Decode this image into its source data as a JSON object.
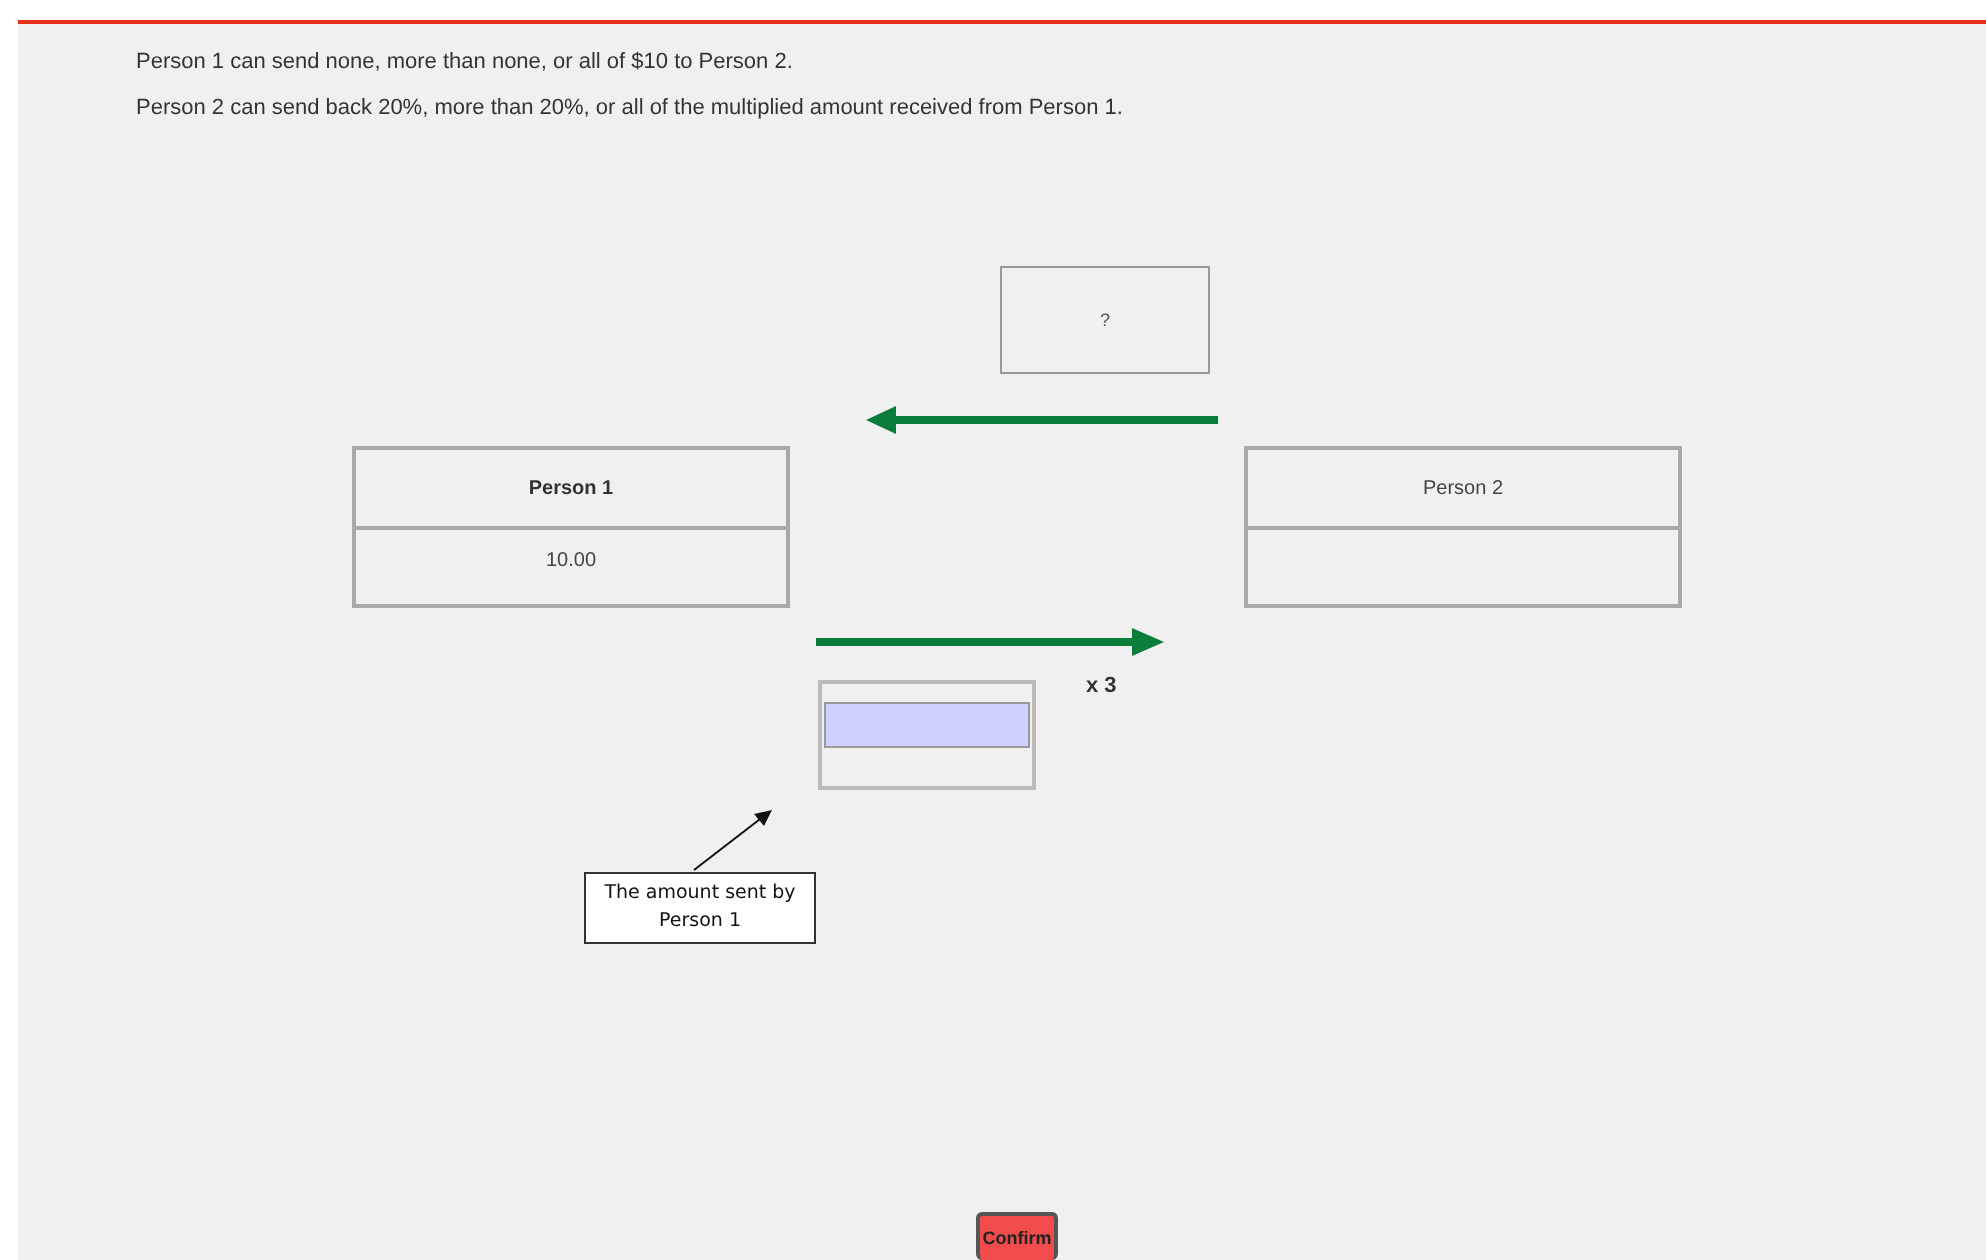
{
  "instructions": [
    "Person 1 can send none, more than none, or all of $10 to Person 2.",
    "Person 2 can send back 20%, more than 20%, or all of the multiplied amount received from Person 1."
  ],
  "returned_amount": "?",
  "players": [
    {
      "name": "Person 1",
      "amount": "10.00",
      "selected": true
    },
    {
      "name": "Person 2",
      "selected": false
    }
  ],
  "multiplier": "x 3",
  "callout": "The amount sent by Person 1",
  "confirm_button": "Confirm"
}
